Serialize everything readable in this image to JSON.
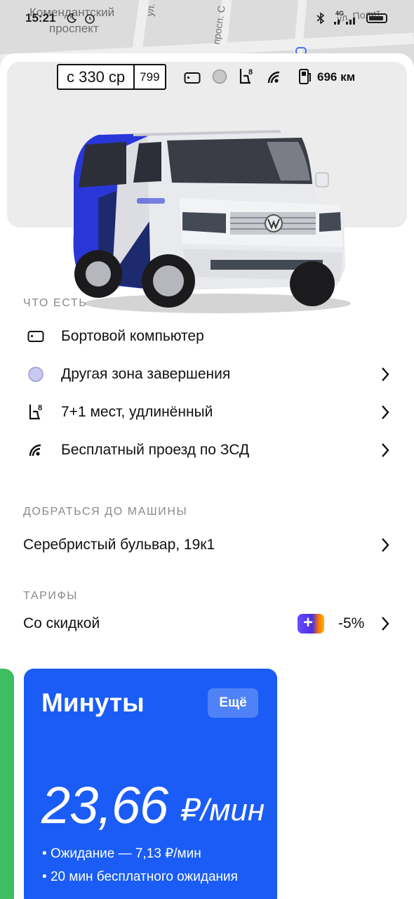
{
  "status_bar": {
    "time": "15:21",
    "network": "4G"
  },
  "map": {
    "labels": {
      "komendantsky": "Комендантский",
      "prospekt": "проспект",
      "street_ma": "ул. Ма",
      "prosp_s": "просп. С",
      "ul_poli": "ул. Полит"
    }
  },
  "car": {
    "plate_number": "с 330 ср",
    "plate_region": "799",
    "range": "696 км",
    "seats_sup": "8",
    "zone_color": "#c8c8f0"
  },
  "features": {
    "heading": "ЧТО ЕСТЬ",
    "items": [
      {
        "label": "Бортовой компьютер",
        "icon": "onboard-computer-icon",
        "chevron": false
      },
      {
        "label": "Другая зона завершения",
        "icon": "zone-dot-icon",
        "chevron": true
      },
      {
        "label": "7+1 мест, удлинённый",
        "icon": "seat-icon",
        "chevron": true
      },
      {
        "label": "Бесплатный проезд по ЗСД",
        "icon": "toll-road-icon",
        "chevron": true
      }
    ]
  },
  "directions": {
    "heading": "ДОБРАТЬСЯ ДО МАШИНЫ",
    "address": "Серебристый бульвар, 19к1"
  },
  "tariffs": {
    "heading": "ТАРИФЫ",
    "discount_label": "Со скидкой",
    "plus_symbol": "+",
    "discount_value": "-5%",
    "card": {
      "title": "Минуты",
      "more_button": "Ещё",
      "price": "23,66",
      "unit": "₽/мин",
      "bullets": [
        "Ожидание — 7,13 ₽/мин",
        "20 мин бесплатного ожидания"
      ]
    }
  },
  "colors": {
    "accent_blue": "#1a5cf5",
    "green_card": "#3ebd62"
  }
}
